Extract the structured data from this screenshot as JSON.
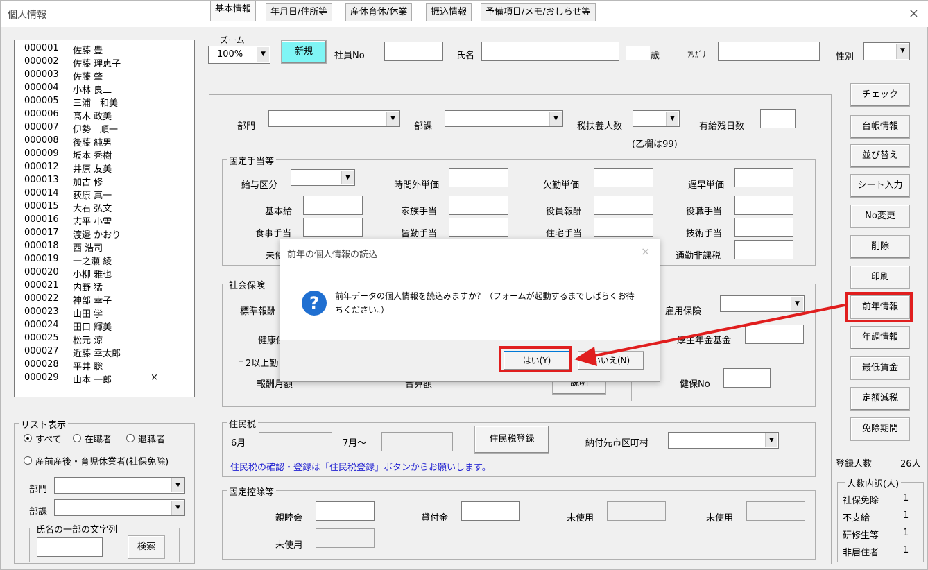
{
  "window": {
    "title": "個人情報",
    "close": "×"
  },
  "employees": [
    {
      "no": "000001",
      "name": "佐藤 豊",
      "mark": ""
    },
    {
      "no": "000002",
      "name": "佐藤 理恵子",
      "mark": ""
    },
    {
      "no": "000003",
      "name": "佐藤 肇",
      "mark": ""
    },
    {
      "no": "000004",
      "name": "小林 良二",
      "mark": ""
    },
    {
      "no": "000005",
      "name": "三浦　和美",
      "mark": ""
    },
    {
      "no": "000006",
      "name": "髙木 政美",
      "mark": ""
    },
    {
      "no": "000007",
      "name": "伊勢　順一",
      "mark": ""
    },
    {
      "no": "000008",
      "name": "後藤 純男",
      "mark": ""
    },
    {
      "no": "000009",
      "name": "坂本 秀樹",
      "mark": ""
    },
    {
      "no": "000012",
      "name": "井原 友美",
      "mark": ""
    },
    {
      "no": "000013",
      "name": "加古 修",
      "mark": ""
    },
    {
      "no": "000014",
      "name": "荻原 真一",
      "mark": ""
    },
    {
      "no": "000015",
      "name": "大石 弘文",
      "mark": ""
    },
    {
      "no": "000016",
      "name": "志平 小雪",
      "mark": ""
    },
    {
      "no": "000017",
      "name": "渡邉 かおり",
      "mark": ""
    },
    {
      "no": "000018",
      "name": "西 浩司",
      "mark": ""
    },
    {
      "no": "000019",
      "name": "一之瀬 綾",
      "mark": ""
    },
    {
      "no": "000020",
      "name": "小柳 雅也",
      "mark": ""
    },
    {
      "no": "000021",
      "name": "内野 猛",
      "mark": ""
    },
    {
      "no": "000022",
      "name": "神部 幸子",
      "mark": ""
    },
    {
      "no": "000023",
      "name": "山田 学",
      "mark": ""
    },
    {
      "no": "000024",
      "name": "田口 輝美",
      "mark": ""
    },
    {
      "no": "000025",
      "name": "松元 涼",
      "mark": ""
    },
    {
      "no": "000027",
      "name": "近藤 幸太郎",
      "mark": ""
    },
    {
      "no": "000028",
      "name": "平井 聡",
      "mark": ""
    },
    {
      "no": "000029",
      "name": "山本 一郎",
      "mark": "×"
    }
  ],
  "list_display": {
    "title": "リスト表示",
    "opt_all": "すべて",
    "opt_active": "在職者",
    "opt_retired": "退職者",
    "opt_leave": "産前産後・育児休業者(社保免除)",
    "dept": "部門",
    "section": "部課",
    "name_group": "氏名の一部の文字列",
    "search_btn": "検索"
  },
  "header": {
    "zoom_label": "ズーム",
    "zoom_value": "100%",
    "new_btn": "新規",
    "emp_no": "社員No",
    "name": "氏名",
    "age": "歳",
    "furigana": "ﾌﾘｶﾞﾅ",
    "gender": "性別"
  },
  "tabs": [
    "基本情報",
    "年月日/住所等",
    "産休育休/休業",
    "振込情報",
    "予備項目/メモ/おしらせ等"
  ],
  "basic": {
    "dept": "部門",
    "section": "部課",
    "dependents": "税扶養人数",
    "dependents_note": "(乙欄は99)",
    "paid_leave": "有給残日数"
  },
  "allowances": {
    "title": "固定手当等",
    "pay_class": "給与区分",
    "overtime_rate": "時間外単価",
    "absence_rate": "欠勤単価",
    "late_rate": "遅早単価",
    "base_pay": "基本給",
    "family": "家族手当",
    "officer": "役員報酬",
    "position": "役職手当",
    "meal": "食事手当",
    "attendance": "皆勤手当",
    "housing": "住宅手当",
    "skill": "技術手当",
    "unused_partial": "未使",
    "commute_nontax": "通勤非課税"
  },
  "social": {
    "title": "社会保険",
    "std_pay_partial": "標準報酬",
    "health_partial": "健康保",
    "employment": "雇用保険",
    "pension_fund": "厚生年金基金",
    "kenpo_no": "健保No",
    "twoplus_partial": "2以上勤",
    "pay_month_partial": "報酬月額",
    "total_partial": "合算額",
    "explain_partial": "説明"
  },
  "resident_tax": {
    "title": "住民税",
    "june": "6月",
    "july": "7月～",
    "register_btn": "住民税登録",
    "municipality": "納付先市区町村",
    "note": "住民税の確認・登録は「住民税登録」ボタンからお願いします。"
  },
  "deductions": {
    "title": "固定控除等",
    "fellowship": "親睦会",
    "loan": "貸付金",
    "unused": "未使用"
  },
  "side_buttons": [
    "チェック",
    "台帳情報",
    "並び替え",
    "シート入力",
    "No変更",
    "削除",
    "印刷",
    "前年情報",
    "年調情報",
    "最低賃金",
    "定額減税",
    "免除期間"
  ],
  "stats": {
    "registered_label": "登録人数",
    "registered_value": "26人",
    "breakdown_title": "人数内訳(人)",
    "items": [
      {
        "label": "社保免除",
        "value": "1"
      },
      {
        "label": "不支給",
        "value": "1"
      },
      {
        "label": "研修生等",
        "value": "1"
      },
      {
        "label": "非居住者",
        "value": "1"
      }
    ]
  },
  "dialog": {
    "title": "前年の個人情報の読込",
    "message_line1": "前年データの個人情報を読込みますか？（フォームが起動するまでしばらくお待",
    "message_line2": "ちください。）",
    "yes": "はい(Y)",
    "no": "いいえ(N)",
    "close": "×",
    "icon": "?"
  },
  "colors": {
    "highlight": "#e01e1e",
    "new_button": "#7ff5f5",
    "question_icon": "#1f6fd1",
    "note_text": "#1f1fd1"
  }
}
